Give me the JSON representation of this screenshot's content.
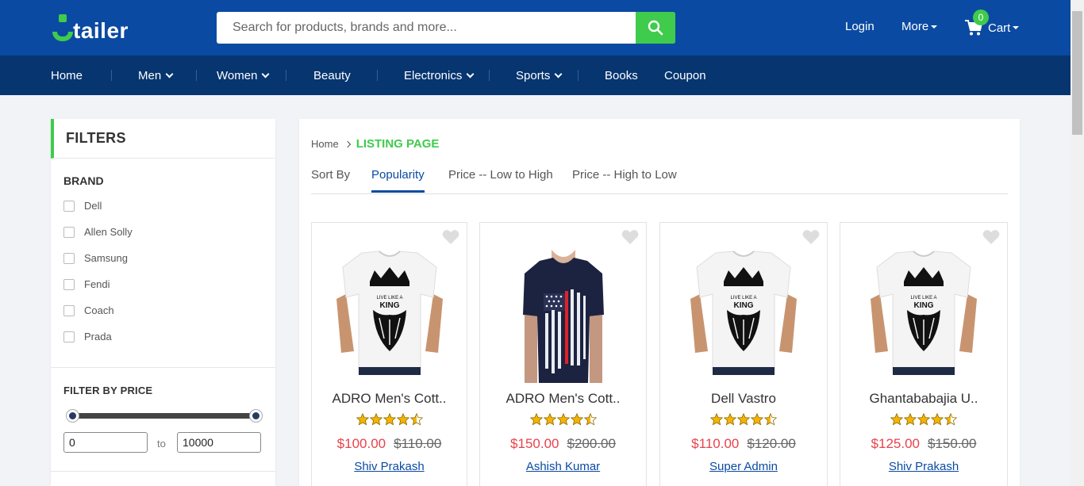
{
  "brand": {
    "logo_text": "tailer",
    "logo_letter": "U"
  },
  "search": {
    "placeholder": "Search for products, brands and more..."
  },
  "header": {
    "login": "Login",
    "more": "More",
    "cart": "Cart",
    "cart_count": "0"
  },
  "nav": {
    "items": [
      {
        "label": "Home",
        "dropdown": false
      },
      {
        "label": "Men",
        "dropdown": true
      },
      {
        "label": "Women",
        "dropdown": true
      },
      {
        "label": "Beauty",
        "dropdown": false
      },
      {
        "label": "Electronics",
        "dropdown": true
      },
      {
        "label": "Sports",
        "dropdown": true
      },
      {
        "label": "Books",
        "dropdown": false
      },
      {
        "label": "Coupon",
        "dropdown": false
      }
    ]
  },
  "filters": {
    "title": "FILTERS",
    "brand_title": "BRAND",
    "brands": [
      "Dell",
      "Allen Solly",
      "Samsung",
      "Fendi",
      "Coach",
      "Prada"
    ],
    "price_title": "FILTER BY PRICE",
    "price_min": "0",
    "price_max": "10000",
    "price_to": "to"
  },
  "listing": {
    "breadcrumb_home": "Home",
    "breadcrumb_current": "LISTING PAGE",
    "sort_label": "Sort By",
    "sort_options": [
      "Popularity",
      "Price -- Low to High",
      "Price -- High to Low"
    ],
    "active_sort": "Popularity",
    "products": [
      {
        "name": "ADRO Men's Cott..",
        "price": "$100.00",
        "old_price": "$110.00",
        "seller": "Shiv Prakash",
        "rating": 4.5,
        "image": "white-king-tshirt"
      },
      {
        "name": "ADRO Men's Cott..",
        "price": "$150.00",
        "old_price": "$200.00",
        "seller": "Ashish Kumar",
        "rating": 4.5,
        "image": "navy-flag-tshirt"
      },
      {
        "name": "Dell Vastro",
        "price": "$110.00",
        "old_price": "$120.00",
        "seller": "Super Admin",
        "rating": 4.5,
        "image": "white-king-tshirt"
      },
      {
        "name": "Ghantababajia U..",
        "price": "$125.00",
        "old_price": "$150.00",
        "seller": "Shiv Prakash",
        "rating": 4.5,
        "image": "white-king-tshirt"
      }
    ]
  },
  "colors": {
    "primary": "#0b4aa2",
    "nav": "#06356f",
    "accent": "#3fcb4b",
    "price": "#e8424b",
    "star": "#f5b301"
  }
}
